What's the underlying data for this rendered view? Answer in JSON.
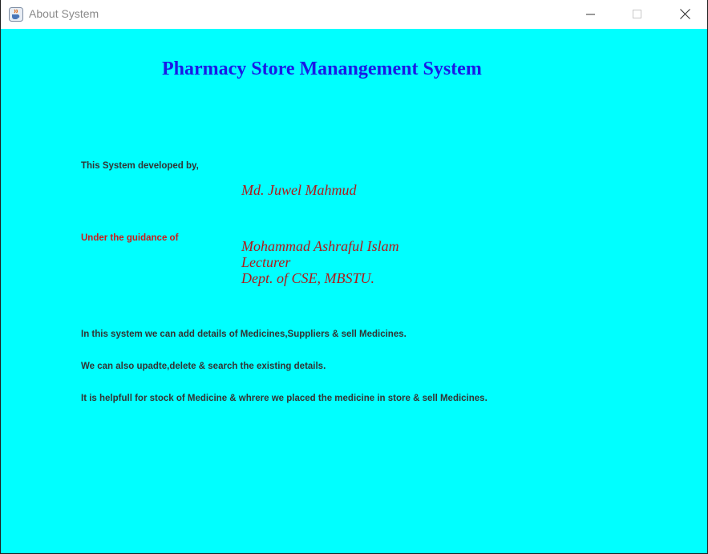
{
  "window": {
    "title": "About System",
    "icon": "java-cup-icon",
    "controls": [
      "minimize-icon",
      "maximize-icon",
      "close-icon"
    ]
  },
  "colors": {
    "background": "#00ffff",
    "heading": "#1a1ae6",
    "name_text": "#b01a1a",
    "guidance_label": "#d01818",
    "body_text": "#333333"
  },
  "about": {
    "heading": "Pharmacy Store Manangement System",
    "developed_by_label": "This System developed by,",
    "developer_name": "Md. Juwel Mahmud",
    "guidance_label": "Under the guidance of",
    "guide_name": "Mohammad Ashraful Islam",
    "guide_title": "Lecturer",
    "guide_dept": "Dept. of CSE, MBSTU.",
    "description_lines": [
      "In this system we can add details of Medicines,Suppliers & sell Medicines.",
      "We can also upadte,delete & search the existing details.",
      "It is helpfull for stock of Medicine & whrere we placed the medicine in store & sell Medicines."
    ]
  }
}
